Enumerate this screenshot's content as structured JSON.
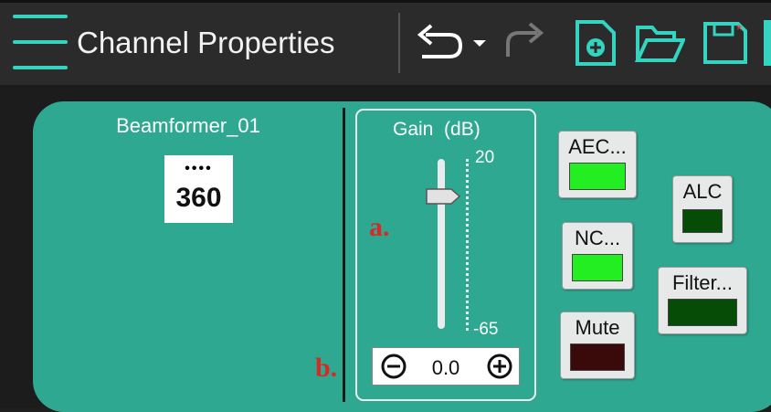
{
  "header": {
    "title": "Channel Properties",
    "toolbar": {
      "undo": "undo-icon",
      "undo_menu": "chevron-down-icon",
      "redo": "redo-icon",
      "new_file": "new-file-icon",
      "open_folder": "open-folder-icon",
      "save": "save-icon"
    }
  },
  "channel": {
    "device_name": "Beamformer_01",
    "device_icon_text": "360"
  },
  "gain": {
    "label": "Gain",
    "unit": "(dB)",
    "max": "20",
    "min": "-65",
    "value": "0.0",
    "slider_level_db": 0
  },
  "annotations": {
    "a": "a.",
    "b": "b."
  },
  "dsp_buttons": [
    {
      "label": "AEC...",
      "state": "on",
      "color": "#22ee22"
    },
    {
      "label": "NC...",
      "state": "on",
      "color": "#22ee22"
    },
    {
      "label": "Mute",
      "state": "off",
      "color": "#3a0a0a"
    },
    {
      "label": "ALC",
      "state": "off",
      "color": "#064b06"
    },
    {
      "label": "Filter...",
      "state": "off",
      "color": "#064b06"
    }
  ],
  "colors": {
    "accent": "#35d4c1",
    "panel": "#2fa892",
    "header_bg": "#2b2b2b",
    "annotation": "#d82a24"
  }
}
